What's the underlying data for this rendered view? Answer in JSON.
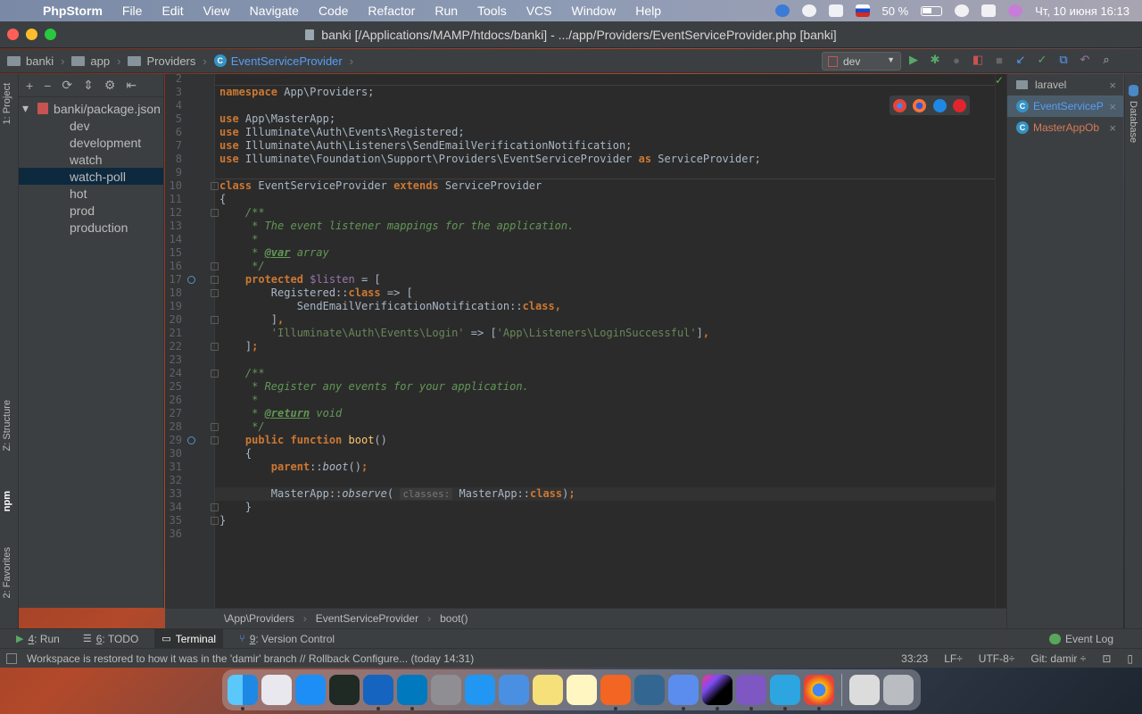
{
  "menubar": {
    "app_name": "PhpStorm",
    "items": [
      "File",
      "Edit",
      "View",
      "Navigate",
      "Code",
      "Refactor",
      "Run",
      "Tools",
      "VCS",
      "Window",
      "Help"
    ],
    "battery": "50 %",
    "datetime": "Чт, 10 июня  16:13"
  },
  "window": {
    "title": "banki [/Applications/MAMP/htdocs/banki] - .../app/Providers/EventServiceProvider.php [banki]"
  },
  "navbar": {
    "crumbs": [
      "banki",
      "app",
      "Providers",
      "EventServiceProvider"
    ],
    "run_config": "dev"
  },
  "left_tabs": {
    "project": "1: Project",
    "structure": "Z: Structure",
    "npm": "npm",
    "favorites": "2: Favorites"
  },
  "project_tree": {
    "root": "banki/package.json",
    "children": [
      "dev",
      "development",
      "watch",
      "watch-poll",
      "hot",
      "prod",
      "production"
    ],
    "selected": "watch-poll"
  },
  "editor": {
    "lines": [
      {
        "n": "2",
        "html": ""
      },
      {
        "n": "3",
        "html": "<span class='kw'>namespace</span> App\\Providers;"
      },
      {
        "n": "4",
        "html": ""
      },
      {
        "n": "5",
        "html": "<span class='kw'>use</span> App\\MasterApp;"
      },
      {
        "n": "6",
        "html": "<span class='kw'>use</span> Illuminate\\Auth\\Events\\Registered;"
      },
      {
        "n": "7",
        "html": "<span class='kw'>use</span> Illuminate\\Auth\\Listeners\\SendEmailVerificationNotification;"
      },
      {
        "n": "8",
        "html": "<span class='kw'>use</span> Illuminate\\Foundation\\Support\\Providers\\EventServiceProvider <span class='kw'>as</span> ServiceProvider;"
      },
      {
        "n": "9",
        "html": ""
      },
      {
        "n": "10",
        "html": "<span class='kw'>class</span> EventServiceProvider <span class='kw'>extends</span> ServiceProvider"
      },
      {
        "n": "11",
        "html": "{"
      },
      {
        "n": "12",
        "html": "    <span class='doc'>/**</span>"
      },
      {
        "n": "13",
        "html": "<span class='doc'>     * The event listener mappings for the application.</span>"
      },
      {
        "n": "14",
        "html": "<span class='doc'>     *</span>"
      },
      {
        "n": "15",
        "html": "<span class='doc'>     * </span><span class='doctag'>@var</span><span class='doc'> array</span>"
      },
      {
        "n": "16",
        "html": "<span class='doc'>     */</span>"
      },
      {
        "n": "17",
        "html": "    <span class='kw'>protected</span> <span class='var'>$listen</span> = ["
      },
      {
        "n": "18",
        "html": "        Registered::<span class='kw'>class</span> => ["
      },
      {
        "n": "19",
        "html": "            SendEmailVerificationNotification::<span class='kw'>class</span><span class='kw'>,</span>"
      },
      {
        "n": "20",
        "html": "        ]<span class='kw'>,</span>"
      },
      {
        "n": "21",
        "html": "        <span class='str'>'Illuminate\\Auth\\Events\\Login'</span> => [<span class='str'>'App\\Listeners\\LoginSuccessful'</span>]<span class='kw'>,</span>"
      },
      {
        "n": "22",
        "html": "    ]<span class='kw'>;</span>"
      },
      {
        "n": "23",
        "html": ""
      },
      {
        "n": "24",
        "html": "    <span class='doc'>/**</span>"
      },
      {
        "n": "25",
        "html": "<span class='doc'>     * Register any events for your application.</span>"
      },
      {
        "n": "26",
        "html": "<span class='doc'>     *</span>"
      },
      {
        "n": "27",
        "html": "<span class='doc'>     * </span><span class='doctag'>@return</span><span class='doc'> void</span>"
      },
      {
        "n": "28",
        "html": "<span class='doc'>     */</span>"
      },
      {
        "n": "29",
        "html": "    <span class='kw'>public function</span> <span class='fn'>boot</span>()"
      },
      {
        "n": "30",
        "html": "    {"
      },
      {
        "n": "31",
        "html": "        <span class='kw'>parent</span>::<span class='it'>boot</span>()<span class='kw'>;</span>"
      },
      {
        "n": "32",
        "html": ""
      },
      {
        "n": "33",
        "html": "        MasterApp::<span class='it'>observe</span>( <span class='hint'>classes:</span> MasterApp::<span class='kw'>class</span>)<span class='kw'>;</span>"
      },
      {
        "n": "34",
        "html": "    }"
      },
      {
        "n": "35",
        "html": "}"
      },
      {
        "n": "36",
        "html": ""
      }
    ]
  },
  "right_tabs": {
    "items": [
      "laravel",
      "EventServiceP",
      "MasterAppOb"
    ],
    "database_tab": "Database"
  },
  "editor_breadcrumb": [
    "\\App\\Providers",
    "EventServiceProvider",
    "boot()"
  ],
  "bottom_tools": {
    "run": {
      "num": "4",
      "label": ": Run"
    },
    "todo": {
      "num": "6",
      "label": ": TODO"
    },
    "terminal": "Terminal",
    "vcs": {
      "num": "9",
      "label": ": Version Control"
    },
    "event_log": "Event Log"
  },
  "statusbar": {
    "message": "Workspace is restored to how it was in the 'damir' branch // Rollback Configure... (today 14:31)",
    "position": "33:23",
    "line_sep": "LF÷",
    "encoding": "UTF-8÷",
    "git": "Git: damir ÷"
  },
  "colors": {
    "editor_bg": "#2b2b2b",
    "keyword": "#cc7832",
    "string": "#6a8759",
    "doc": "#629755",
    "accent_blue": "#589df6"
  },
  "dock_apps": [
    "finder-icon",
    "launchpad-icon",
    "app-store-icon",
    "activity-monitor-icon",
    "sourcetree-icon",
    "trello-icon",
    "system-prefs-icon",
    "safari-icon",
    "mail-icon",
    "notes-icon",
    "stickies-icon",
    "pencil-icon",
    "pgadmin-icon",
    "tableplus-icon",
    "phpstorm-icon",
    "vscode-icon",
    "telegram-icon",
    "chrome-icon",
    "folder-icon",
    "trash-icon"
  ]
}
